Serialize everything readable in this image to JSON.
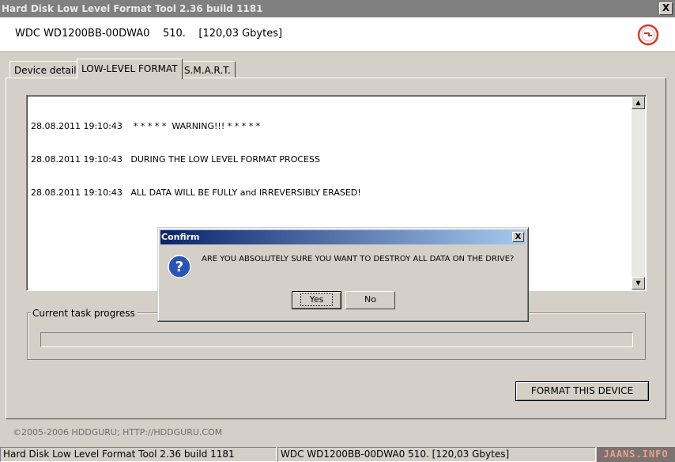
{
  "window": {
    "title": "Hard Disk Low Level Format Tool 2.36 build 1181",
    "close_label": "X"
  },
  "header": {
    "device_info": "WDC WD1200BB-00DWA0    510.    [120,03 Gbytes]",
    "logo_icon": "hddguru-logo-icon"
  },
  "tabs": [
    {
      "label": "Device details",
      "active": false
    },
    {
      "label": "LOW-LEVEL FORMAT",
      "active": true
    },
    {
      "label": "S.M.A.R.T.",
      "active": false
    }
  ],
  "log": {
    "lines": [
      "28.08.2011 19:10:43    * * * * *  WARNING!!! * * * * *",
      "28.08.2011 19:10:43   DURING THE LOW LEVEL FORMAT PROCESS",
      "28.08.2011 19:10:43   ALL DATA WILL BE FULLY and IRREVERSIBLY ERASED!"
    ]
  },
  "progress": {
    "label": "Current task progress",
    "value": 0
  },
  "format_button": "FORMAT THIS DEVICE",
  "copyright": "©2005-2006 HDDGURU;  HTTP://HDDGURU.COM",
  "statusbar": {
    "app": "Hard Disk Low Level Format Tool 2.36 build 1181",
    "device": "WDC WD1200BB-00DWA0     510.     [120,03 Gbytes]",
    "watermark": "JAANS.INFO"
  },
  "dialog": {
    "title": "Confirm",
    "close_label": "X",
    "icon": "question-icon",
    "message": "ARE YOU ABSOLUTELY SURE YOU WANT TO DESTROY ALL DATA ON THE DRIVE?",
    "yes_label": "Yes",
    "no_label": "No"
  },
  "colors": {
    "dialog_title_start": "#0a246a",
    "dialog_title_end": "#a6caf0",
    "window_face": "#d4d0c8"
  }
}
